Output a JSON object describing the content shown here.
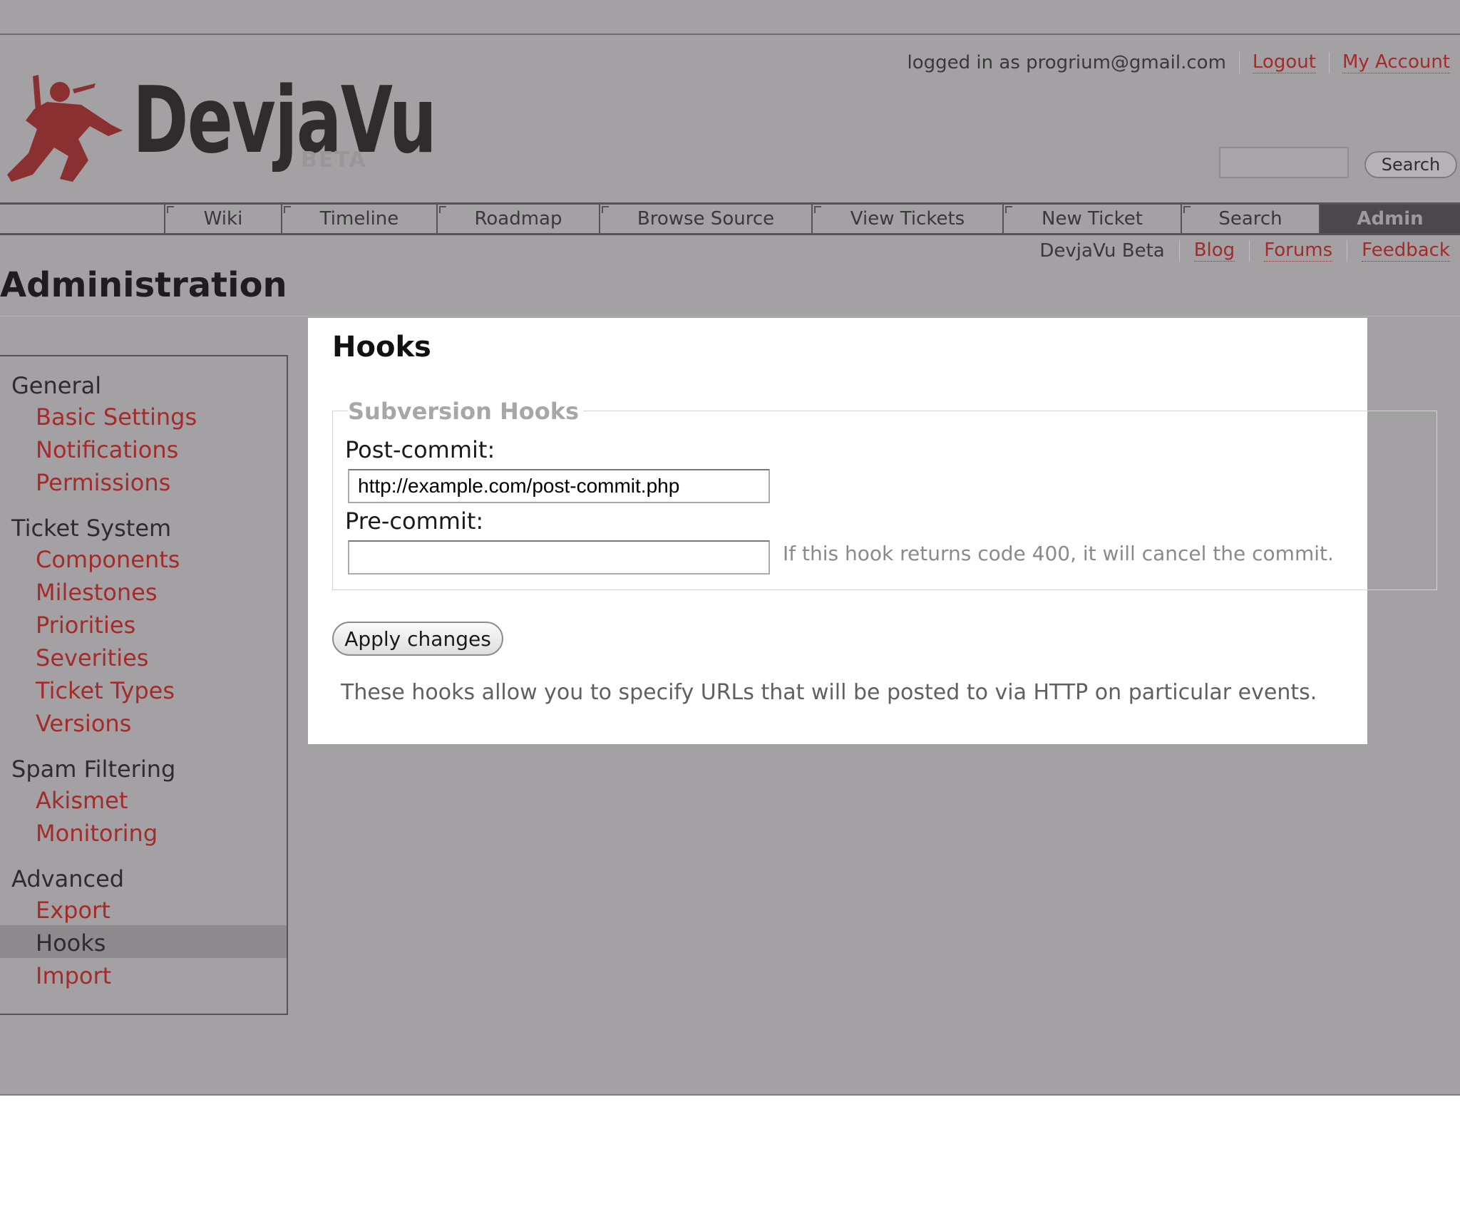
{
  "header": {
    "logo_text": "DevjaVu",
    "logo_badge": "BETA",
    "logged_in_text": "logged in as progrium@gmail.com",
    "logout_label": "Logout",
    "my_account_label": "My Account",
    "search_button_label": "Search"
  },
  "nav": {
    "items": [
      {
        "label": "Wiki"
      },
      {
        "label": "Timeline"
      },
      {
        "label": "Roadmap"
      },
      {
        "label": "Browse Source"
      },
      {
        "label": "View Tickets"
      },
      {
        "label": "New Ticket"
      },
      {
        "label": "Search"
      },
      {
        "label": "Admin"
      }
    ]
  },
  "subnav": {
    "items": [
      "DevjaVu Beta",
      "Blog",
      "Forums",
      "Feedback"
    ]
  },
  "page_title": "Administration",
  "sidebar": {
    "groups": [
      {
        "label": "General",
        "items": [
          "Basic Settings",
          "Notifications",
          "Permissions"
        ]
      },
      {
        "label": "Ticket System",
        "items": [
          "Components",
          "Milestones",
          "Priorities",
          "Severities",
          "Ticket Types",
          "Versions"
        ]
      },
      {
        "label": "Spam Filtering",
        "items": [
          "Akismet",
          "Monitoring"
        ]
      },
      {
        "label": "Advanced",
        "items": [
          "Export",
          "Hooks",
          "Import"
        ]
      }
    ],
    "selected": "Hooks"
  },
  "hooks": {
    "title": "Hooks",
    "legend": "Subversion Hooks",
    "post_commit_label": "Post-commit:",
    "post_commit_value": "http://example.com/post-commit.php",
    "pre_commit_label": "Pre-commit:",
    "pre_commit_value": "",
    "pre_commit_hint": "If this hook returns code 400, it will cancel the commit.",
    "apply_label": "Apply changes",
    "description": "These hooks allow you to specify URLs that will be posted to via HTTP on particular events."
  },
  "colors": {
    "backdrop": "#a3a1a3",
    "link": "#a52a2a",
    "active_tab": "#4a484a"
  }
}
